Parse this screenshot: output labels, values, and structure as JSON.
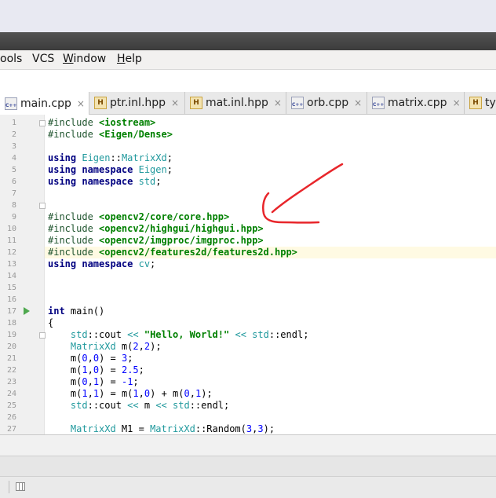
{
  "menu": {
    "items": [
      {
        "label_pre": "ools",
        "label_u": "",
        "label_post": ""
      },
      {
        "label_pre": "VCS",
        "label_u": "",
        "label_post": ""
      },
      {
        "label_pre": "",
        "label_u": "W",
        "label_post": "indow"
      },
      {
        "label_pre": "",
        "label_u": "H",
        "label_post": "elp"
      }
    ]
  },
  "tabs": [
    {
      "label": "main.cpp",
      "icon": "cpp-file-icon",
      "active": true
    },
    {
      "label": "ptr.inl.hpp",
      "icon": "header-file-icon",
      "active": false
    },
    {
      "label": "mat.inl.hpp",
      "icon": "header-file-icon",
      "active": false
    },
    {
      "label": "orb.cpp",
      "icon": "cpp-file-icon",
      "active": false
    },
    {
      "label": "matrix.cpp",
      "icon": "cpp-file-icon",
      "active": false
    },
    {
      "label": "ty",
      "icon": "header-file-icon",
      "active": false
    }
  ],
  "icon_labels": {
    "cpp": "C++",
    "h": "H"
  },
  "close_glyph": "×",
  "editor": {
    "highlighted_line": 12,
    "line_numbers": [
      "1",
      "2",
      "3",
      "4",
      "5",
      "6",
      "7",
      "8",
      "9",
      "10",
      "11",
      "12",
      "13",
      "14",
      "15",
      "16",
      "17",
      "18",
      "19",
      "20",
      "21",
      "22",
      "23",
      "24",
      "25",
      "26",
      "27"
    ],
    "code": [
      {
        "parts": [
          {
            "c": "pp",
            "t": "#include "
          },
          {
            "c": "str",
            "t": "<iostream>"
          }
        ]
      },
      {
        "parts": [
          {
            "c": "pp",
            "t": "#include "
          },
          {
            "c": "str",
            "t": "<Eigen/Dense>"
          }
        ]
      },
      {
        "parts": []
      },
      {
        "parts": [
          {
            "c": "kw",
            "t": "using "
          },
          {
            "c": "ty",
            "t": "Eigen"
          },
          {
            "c": "",
            "t": "::"
          },
          {
            "c": "ty",
            "t": "MatrixXd"
          },
          {
            "c": "",
            "t": ";"
          }
        ]
      },
      {
        "parts": [
          {
            "c": "kw",
            "t": "using namespace "
          },
          {
            "c": "ty",
            "t": "Eigen"
          },
          {
            "c": "",
            "t": ";"
          }
        ]
      },
      {
        "parts": [
          {
            "c": "kw",
            "t": "using namespace "
          },
          {
            "c": "ty",
            "t": "std"
          },
          {
            "c": "",
            "t": ";"
          }
        ]
      },
      {
        "parts": []
      },
      {
        "parts": []
      },
      {
        "parts": [
          {
            "c": "pp",
            "t": "#include "
          },
          {
            "c": "str",
            "t": "<opencv2/core/core.hpp>"
          }
        ]
      },
      {
        "parts": [
          {
            "c": "pp",
            "t": "#include "
          },
          {
            "c": "str",
            "t": "<opencv2/highgui/highgui.hpp>"
          }
        ]
      },
      {
        "parts": [
          {
            "c": "pp",
            "t": "#include "
          },
          {
            "c": "str",
            "t": "<opencv2/imgproc/imgproc.hpp>"
          }
        ]
      },
      {
        "parts": [
          {
            "c": "pp",
            "t": "#include "
          },
          {
            "c": "str",
            "t": "<opencv2/features2d/features2d.hpp>"
          }
        ]
      },
      {
        "parts": [
          {
            "c": "kw",
            "t": "using namespace "
          },
          {
            "c": "ty",
            "t": "cv"
          },
          {
            "c": "",
            "t": ";"
          }
        ]
      },
      {
        "parts": []
      },
      {
        "parts": []
      },
      {
        "parts": []
      },
      {
        "parts": [
          {
            "c": "kw",
            "t": "int "
          },
          {
            "c": "",
            "t": "main()"
          }
        ]
      },
      {
        "parts": [
          {
            "c": "",
            "t": "{"
          }
        ]
      },
      {
        "parts": [
          {
            "c": "",
            "t": "    "
          },
          {
            "c": "ty",
            "t": "std"
          },
          {
            "c": "",
            "t": "::cout "
          },
          {
            "c": "ty",
            "t": "<<"
          },
          {
            "c": "",
            "t": " "
          },
          {
            "c": "str",
            "t": "\"Hello, World!\""
          },
          {
            "c": "",
            "t": " "
          },
          {
            "c": "ty",
            "t": "<<"
          },
          {
            "c": "",
            "t": " "
          },
          {
            "c": "ty",
            "t": "std"
          },
          {
            "c": "",
            "t": "::endl;"
          }
        ]
      },
      {
        "parts": [
          {
            "c": "",
            "t": "    "
          },
          {
            "c": "ty",
            "t": "MatrixXd"
          },
          {
            "c": "",
            "t": " m("
          },
          {
            "c": "nm",
            "t": "2"
          },
          {
            "c": "",
            "t": ","
          },
          {
            "c": "nm",
            "t": "2"
          },
          {
            "c": "",
            "t": ");"
          }
        ]
      },
      {
        "parts": [
          {
            "c": "",
            "t": "    m("
          },
          {
            "c": "nm",
            "t": "0"
          },
          {
            "c": "",
            "t": ","
          },
          {
            "c": "nm",
            "t": "0"
          },
          {
            "c": "",
            "t": ") = "
          },
          {
            "c": "nm",
            "t": "3"
          },
          {
            "c": "",
            "t": ";"
          }
        ]
      },
      {
        "parts": [
          {
            "c": "",
            "t": "    m("
          },
          {
            "c": "nm",
            "t": "1"
          },
          {
            "c": "",
            "t": ","
          },
          {
            "c": "nm",
            "t": "0"
          },
          {
            "c": "",
            "t": ") = "
          },
          {
            "c": "nm",
            "t": "2.5"
          },
          {
            "c": "",
            "t": ";"
          }
        ]
      },
      {
        "parts": [
          {
            "c": "",
            "t": "    m("
          },
          {
            "c": "nm",
            "t": "0"
          },
          {
            "c": "",
            "t": ","
          },
          {
            "c": "nm",
            "t": "1"
          },
          {
            "c": "",
            "t": ") = "
          },
          {
            "c": "nm",
            "t": "-1"
          },
          {
            "c": "",
            "t": ";"
          }
        ]
      },
      {
        "parts": [
          {
            "c": "",
            "t": "    m("
          },
          {
            "c": "nm",
            "t": "1"
          },
          {
            "c": "",
            "t": ","
          },
          {
            "c": "nm",
            "t": "1"
          },
          {
            "c": "",
            "t": ") = m("
          },
          {
            "c": "nm",
            "t": "1"
          },
          {
            "c": "",
            "t": ","
          },
          {
            "c": "nm",
            "t": "0"
          },
          {
            "c": "",
            "t": ") + m("
          },
          {
            "c": "nm",
            "t": "0"
          },
          {
            "c": "",
            "t": ","
          },
          {
            "c": "nm",
            "t": "1"
          },
          {
            "c": "",
            "t": ");"
          }
        ]
      },
      {
        "parts": [
          {
            "c": "",
            "t": "    "
          },
          {
            "c": "ty",
            "t": "std"
          },
          {
            "c": "",
            "t": "::cout "
          },
          {
            "c": "ty",
            "t": "<<"
          },
          {
            "c": "",
            "t": " m "
          },
          {
            "c": "ty",
            "t": "<<"
          },
          {
            "c": "",
            "t": " "
          },
          {
            "c": "ty",
            "t": "std"
          },
          {
            "c": "",
            "t": "::endl;"
          }
        ]
      },
      {
        "parts": []
      },
      {
        "parts": [
          {
            "c": "",
            "t": "    "
          },
          {
            "c": "ty",
            "t": "MatrixXd"
          },
          {
            "c": "",
            "t": " M1 = "
          },
          {
            "c": "ty",
            "t": "MatrixXd"
          },
          {
            "c": "",
            "t": "::Random("
          },
          {
            "c": "nm",
            "t": "3"
          },
          {
            "c": "",
            "t": ","
          },
          {
            "c": "nm",
            "t": "3"
          },
          {
            "c": "",
            "t": ");"
          }
        ]
      }
    ]
  },
  "colors": {
    "annotation_arrow": "#e8262b",
    "run_marker": "#4ea84e",
    "line_highlight": "#fffae3"
  }
}
